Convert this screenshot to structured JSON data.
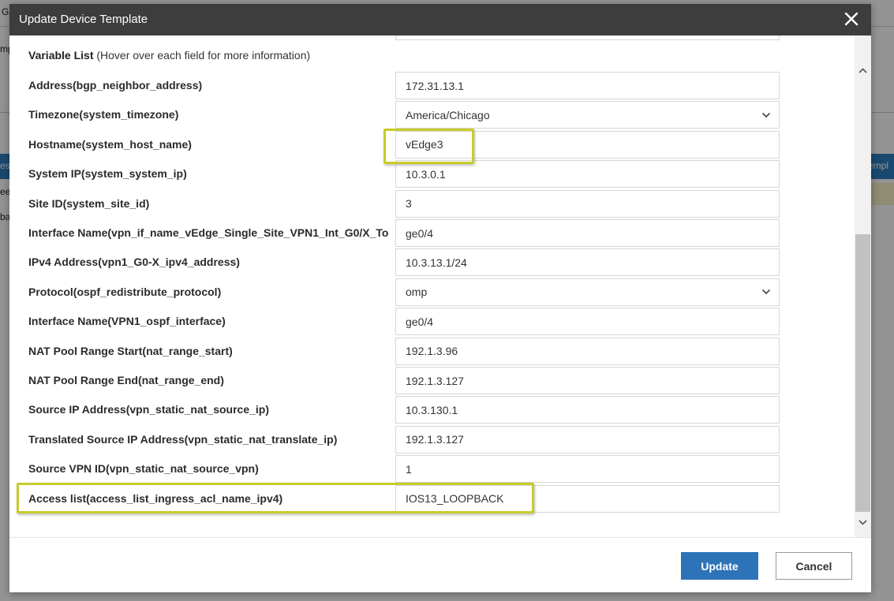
{
  "background": {
    "fragments": [
      "G",
      "mp",
      "es",
      "ee",
      "ba",
      "empl"
    ]
  },
  "dialog": {
    "title": "Update Device Template",
    "variable_list_label": "Variable List",
    "variable_list_hint": "(Hover over each field for more information)",
    "rows": [
      {
        "label": "Address(bgp_neighbor_address)",
        "value": "172.31.13.1",
        "type": "text"
      },
      {
        "label": "Timezone(system_timezone)",
        "value": "America/Chicago",
        "type": "select"
      },
      {
        "label": "Hostname(system_host_name)",
        "value": "vEdge3",
        "type": "text"
      },
      {
        "label": "System IP(system_system_ip)",
        "value": "10.3.0.1",
        "type": "text"
      },
      {
        "label": "Site ID(system_site_id)",
        "value": "3",
        "type": "text"
      },
      {
        "label": "Interface Name(vpn_if_name_vEdge_Single_Site_VPN1_Int_G0/X_To",
        "value": "ge0/4",
        "type": "text"
      },
      {
        "label": "IPv4 Address(vpn1_G0-X_ipv4_address)",
        "value": "10.3.13.1/24",
        "type": "text"
      },
      {
        "label": "Protocol(ospf_redistribute_protocol)",
        "value": "omp",
        "type": "select"
      },
      {
        "label": "Interface Name(VPN1_ospf_interface)",
        "value": "ge0/4",
        "type": "text"
      },
      {
        "label": "NAT Pool Range Start(nat_range_start)",
        "value": "192.1.3.96",
        "type": "text"
      },
      {
        "label": "NAT Pool Range End(nat_range_end)",
        "value": "192.1.3.127",
        "type": "text"
      },
      {
        "label": "Source IP Address(vpn_static_nat_source_ip)",
        "value": "10.3.130.1",
        "type": "text"
      },
      {
        "label": "Translated Source IP Address(vpn_static_nat_translate_ip)",
        "value": "192.1.3.127",
        "type": "text"
      },
      {
        "label": "Source VPN ID(vpn_static_nat_source_vpn)",
        "value": "1",
        "type": "text"
      },
      {
        "label": "Access list(access_list_ingress_acl_name_ipv4)",
        "value": "IOS13_LOOPBACK",
        "type": "text"
      }
    ],
    "buttons": {
      "update_label": "Update",
      "cancel_label": "Cancel"
    }
  },
  "colors": {
    "header_bg": "#3d3d3d",
    "primary_button": "#2d73b8",
    "highlight_border": "#c8cc2a"
  }
}
